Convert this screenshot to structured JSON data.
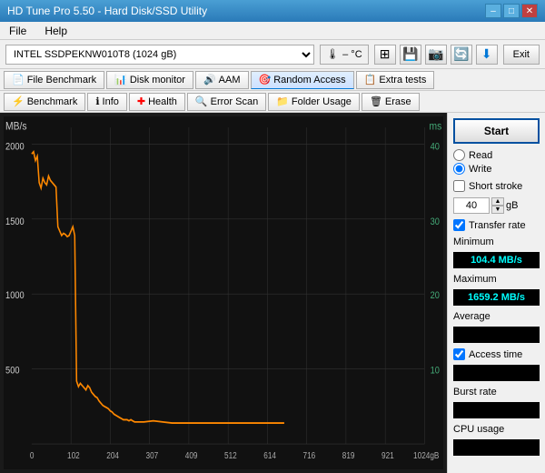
{
  "titleBar": {
    "title": "HD Tune Pro 5.50 - Hard Disk/SSD Utility",
    "minBtn": "–",
    "maxBtn": "□",
    "closeBtn": "✕"
  },
  "menuBar": {
    "items": [
      "File",
      "Help"
    ]
  },
  "toolbar": {
    "driveLabel": "INTEL SSDPEKNW010T8 (1024 gB)",
    "tempSymbol": "🌡",
    "tempValue": "– °C",
    "exitLabel": "Exit"
  },
  "tabRow1": {
    "tabs": [
      {
        "label": "File Benchmark",
        "icon": "📄"
      },
      {
        "label": "Disk monitor",
        "icon": "📊"
      },
      {
        "label": "AAM",
        "icon": "🔊"
      },
      {
        "label": "Random Access",
        "icon": "🎯",
        "active": true
      },
      {
        "label": "Extra tests",
        "icon": "📋"
      }
    ]
  },
  "tabRow2": {
    "tabs": [
      {
        "label": "Benchmark",
        "icon": "⚡"
      },
      {
        "label": "Info",
        "icon": "ℹ"
      },
      {
        "label": "Health",
        "icon": "➕"
      },
      {
        "label": "Error Scan",
        "icon": "🔍"
      },
      {
        "label": "Folder Usage",
        "icon": "📁"
      },
      {
        "label": "Erase",
        "icon": "🗑"
      }
    ]
  },
  "chart": {
    "yLabelLeft": "MB/s",
    "yLabelRight": "ms",
    "yMaxLeft": 2000,
    "yMid1Left": 1500,
    "yMid2Left": 1000,
    "yMid3Left": 500,
    "yMaxRight": 40,
    "yMid1Right": 30,
    "yMid2Right": 20,
    "yMid3Right": 10,
    "xLabels": [
      "0",
      "102",
      "204",
      "307",
      "409",
      "512",
      "614",
      "716",
      "819",
      "921",
      "1024gB"
    ]
  },
  "rightPanel": {
    "startLabel": "Start",
    "readLabel": "Read",
    "writeLabel": "Write",
    "writeChecked": true,
    "shortStrokeLabel": "Short stroke",
    "shortStrokeValue": "40",
    "shortStrokeUnit": "gB",
    "transferRateLabel": "Transfer rate",
    "transferRateChecked": true,
    "minimumLabel": "Minimum",
    "minimumValue": "104.4 MB/s",
    "maximumLabel": "Maximum",
    "maximumValue": "1659.2 MB/s",
    "averageLabel": "Average",
    "averageValue": "",
    "accessTimeLabel": "Access time",
    "accessTimeChecked": true,
    "accessTimeValue": "",
    "burstRateLabel": "Burst rate",
    "burstRateValue": "",
    "cpuUsageLabel": "CPU usage",
    "cpuUsageValue": ""
  }
}
